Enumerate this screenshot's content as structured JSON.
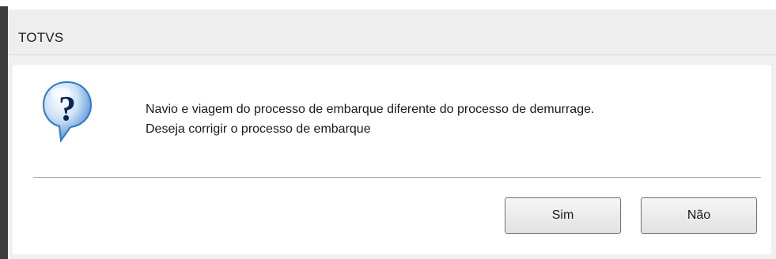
{
  "window": {
    "title": "TOTVS"
  },
  "dialog": {
    "icon": "question-icon",
    "message_line1": "Navio e viagem do processo de embarque diferente do processo de demurrage.",
    "message_line2": "Deseja corrigir o processo de embarque"
  },
  "buttons": {
    "yes_label": "Sim",
    "no_label": "Não"
  },
  "colors": {
    "icon_blue": "#2f79c8",
    "icon_mark": "#0c2550",
    "button_border": "#707070"
  }
}
